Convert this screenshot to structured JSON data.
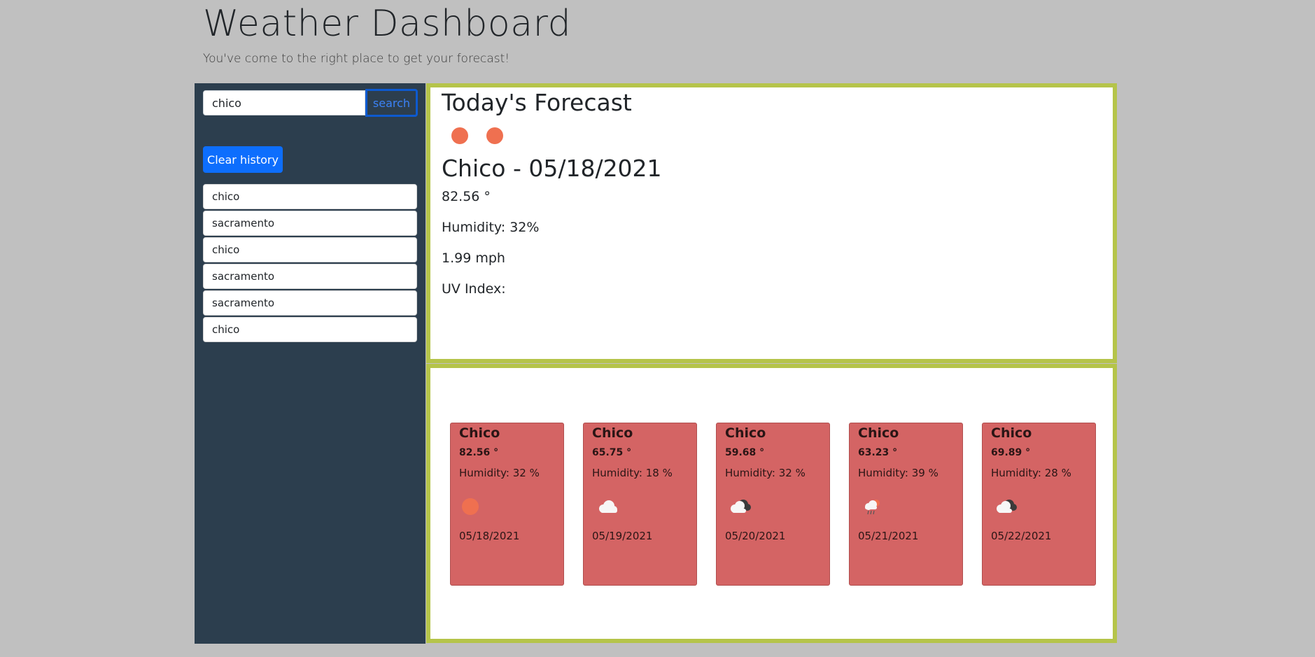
{
  "header": {
    "title": "Weather Dashboard",
    "subtitle": "You've come to the right place to get your forecast!"
  },
  "sidebar": {
    "search": {
      "value": "chico",
      "button_label": "search"
    },
    "clear_label": "Clear history",
    "history": [
      "chico",
      "sacramento",
      "chico",
      "sacramento",
      "sacramento",
      "chico"
    ]
  },
  "today": {
    "heading": "Today's Forecast",
    "icons": [
      "sun-icon",
      "sun-icon"
    ],
    "city_date": "Chico - 05/18/2021",
    "temp": "82.56 °",
    "humidity": "Humidity: 32%",
    "wind": "1.99 mph",
    "uv": "UV Index:"
  },
  "forecast": [
    {
      "city": "Chico",
      "temp": "82.56 °",
      "humidity": "Humidity: 32 %",
      "icon": "sun-icon",
      "date": "05/18/2021"
    },
    {
      "city": "Chico",
      "temp": "65.75 °",
      "humidity": "Humidity: 18 %",
      "icon": "cloud-icon",
      "date": "05/19/2021"
    },
    {
      "city": "Chico",
      "temp": "59.68 °",
      "humidity": "Humidity: 32 %",
      "icon": "broken-clouds-icon",
      "date": "05/20/2021"
    },
    {
      "city": "Chico",
      "temp": "63.23 °",
      "humidity": "Humidity: 39 %",
      "icon": "rain-icon",
      "date": "05/21/2021"
    },
    {
      "city": "Chico",
      "temp": "69.89 °",
      "humidity": "Humidity: 28 %",
      "icon": "broken-clouds-icon",
      "date": "05/22/2021"
    }
  ],
  "colors": {
    "page_bg": "#c0c0c0",
    "sidebar_bg": "#2c3e4e",
    "panel_border": "#b5c44a",
    "card_bg": "#d46464",
    "accent": "#0d6efd",
    "sun": "#ef7050"
  }
}
